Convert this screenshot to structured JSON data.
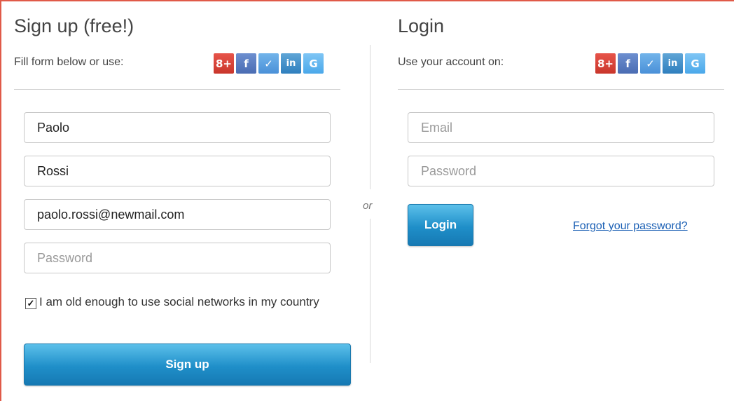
{
  "signup": {
    "title": "Sign up (free!)",
    "subtitle": "Fill form below or use:",
    "first_name": "Paolo",
    "last_name": "Rossi",
    "email": "paolo.rossi@newmail.com",
    "password_placeholder": "Password",
    "age_checkbox_checked": true,
    "age_checkbox_label": "I am old enough to use social networks in my country",
    "submit_label": "Sign up"
  },
  "login": {
    "title": "Login",
    "subtitle": "Use your account on:",
    "email_placeholder": "Email",
    "password_placeholder": "Password",
    "submit_label": "Login",
    "forgot_link": "Forgot your password?"
  },
  "divider_text": "or",
  "social": {
    "google_plus": "8+",
    "facebook": "f",
    "messenger": "✓",
    "linkedin": "in",
    "google": "G"
  },
  "colors": {
    "accent_border": "#e05a48",
    "button_blue": "#1f8fc9",
    "link_blue": "#1a5fb4"
  }
}
